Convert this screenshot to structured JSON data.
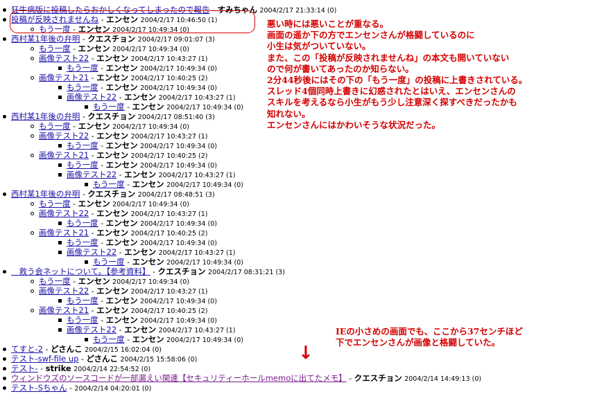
{
  "threads": [
    {
      "id": "r0",
      "level": 0,
      "bullet": "disc",
      "title": "狂牛病版に投稿したらおかしくなってしまったので報告",
      "sep": " - ",
      "author": "すみちゃん",
      "meta": "2004/2/17 21:33:14 (0)",
      "link": "blue"
    },
    {
      "id": "r1",
      "level": 0,
      "bullet": "disc",
      "title": "投稿が反映されませんね",
      "sep": " - ",
      "author": "エンセン",
      "meta": "2004/2/17 10:46:50 (1)",
      "link": "blue"
    },
    {
      "id": "r2",
      "level": 1,
      "bullet": "circle",
      "title": "もう一度",
      "sep": " - ",
      "author": "エンセン",
      "meta": "2004/2/17 10:49:34 (0)",
      "link": "blue"
    },
    {
      "id": "r3",
      "level": 0,
      "bullet": "disc",
      "title": "西村某1年後の弁明",
      "sep": " - ",
      "author": "クエスチョン",
      "meta": "2004/2/17 09:01:07 (3)",
      "link": "blue"
    },
    {
      "id": "r4",
      "level": 1,
      "bullet": "circle",
      "title": "もう一度",
      "sep": " - ",
      "author": "エンセン",
      "meta": "2004/2/17 10:49:34 (0)",
      "link": "blue"
    },
    {
      "id": "r5",
      "level": 1,
      "bullet": "circle",
      "title": "画像テスト22",
      "sep": " - ",
      "author": "エンセン",
      "meta": "2004/2/17 10:43:27 (1)",
      "link": "blue"
    },
    {
      "id": "r6",
      "level": 2,
      "bullet": "square",
      "title": "もう一度",
      "sep": " - ",
      "author": "エンセン",
      "meta": "2004/2/17 10:49:34 (0)",
      "link": "blue"
    },
    {
      "id": "r7",
      "level": 1,
      "bullet": "circle",
      "title": "画像テスト21",
      "sep": " - ",
      "author": "エンセン",
      "meta": "2004/2/17 10:40:25 (2)",
      "link": "blue"
    },
    {
      "id": "r8",
      "level": 2,
      "bullet": "square",
      "title": "もう一度",
      "sep": " - ",
      "author": "エンセン",
      "meta": "2004/2/17 10:49:34 (0)",
      "link": "blue"
    },
    {
      "id": "r9",
      "level": 2,
      "bullet": "square",
      "title": "画像テスト22",
      "sep": " - ",
      "author": "エンセン",
      "meta": "2004/2/17 10:43:27 (1)",
      "link": "blue"
    },
    {
      "id": "r10",
      "level": 3,
      "bullet": "square",
      "title": "もう一度",
      "sep": " - ",
      "author": "エンセン",
      "meta": "2004/2/17 10:49:34 (0)",
      "link": "blue"
    },
    {
      "id": "r11",
      "level": 0,
      "bullet": "disc",
      "title": "西村某1年後の弁明",
      "sep": " - ",
      "author": "クエスチョン",
      "meta": "2004/2/17 08:51:40 (3)",
      "link": "blue"
    },
    {
      "id": "r12",
      "level": 1,
      "bullet": "circle",
      "title": "もう一度",
      "sep": " - ",
      "author": "エンセン",
      "meta": "2004/2/17 10:49:34 (0)",
      "link": "blue"
    },
    {
      "id": "r13",
      "level": 1,
      "bullet": "circle",
      "title": "画像テスト22",
      "sep": " - ",
      "author": "エンセン",
      "meta": "2004/2/17 10:43:27 (1)",
      "link": "blue"
    },
    {
      "id": "r14",
      "level": 2,
      "bullet": "square",
      "title": "もう一度",
      "sep": " - ",
      "author": "エンセン",
      "meta": "2004/2/17 10:49:34 (0)",
      "link": "blue"
    },
    {
      "id": "r15",
      "level": 1,
      "bullet": "circle",
      "title": "画像テスト21",
      "sep": " - ",
      "author": "エンセン",
      "meta": "2004/2/17 10:40:25 (2)",
      "link": "blue"
    },
    {
      "id": "r16",
      "level": 2,
      "bullet": "square",
      "title": "もう一度",
      "sep": " - ",
      "author": "エンセン",
      "meta": "2004/2/17 10:49:34 (0)",
      "link": "blue"
    },
    {
      "id": "r17",
      "level": 2,
      "bullet": "square",
      "title": "画像テスト22",
      "sep": " - ",
      "author": "エンセン",
      "meta": "2004/2/17 10:43:27 (1)",
      "link": "blue"
    },
    {
      "id": "r18",
      "level": 3,
      "bullet": "square",
      "title": "もう一度",
      "sep": " - ",
      "author": "エンセン",
      "meta": "2004/2/17 10:49:34 (0)",
      "link": "blue"
    },
    {
      "id": "r19",
      "level": 0,
      "bullet": "disc",
      "title": "西村某1年後の弁明",
      "sep": " - ",
      "author": "クエスチョン",
      "meta": "2004/2/17 08:48:51 (3)",
      "link": "blue"
    },
    {
      "id": "r20",
      "level": 1,
      "bullet": "circle",
      "title": "もう一度",
      "sep": " - ",
      "author": "エンセン",
      "meta": "2004/2/17 10:49:34 (0)",
      "link": "blue"
    },
    {
      "id": "r21",
      "level": 1,
      "bullet": "circle",
      "title": "画像テスト22",
      "sep": " - ",
      "author": "エンセン",
      "meta": "2004/2/17 10:43:27 (1)",
      "link": "blue"
    },
    {
      "id": "r22",
      "level": 2,
      "bullet": "square",
      "title": "もう一度",
      "sep": " - ",
      "author": "エンセン",
      "meta": "2004/2/17 10:49:34 (0)",
      "link": "blue"
    },
    {
      "id": "r23",
      "level": 1,
      "bullet": "circle",
      "title": "画像テスト21",
      "sep": " - ",
      "author": "エンセン",
      "meta": "2004/2/17 10:40:25 (2)",
      "link": "blue"
    },
    {
      "id": "r24",
      "level": 2,
      "bullet": "square",
      "title": "もう一度",
      "sep": " - ",
      "author": "エンセン",
      "meta": "2004/2/17 10:49:34 (0)",
      "link": "blue"
    },
    {
      "id": "r25",
      "level": 2,
      "bullet": "square",
      "title": "画像テスト22",
      "sep": " - ",
      "author": "エンセン",
      "meta": "2004/2/17 10:43:27 (1)",
      "link": "blue"
    },
    {
      "id": "r26",
      "level": 3,
      "bullet": "square",
      "title": "もう一度",
      "sep": " - ",
      "author": "エンセン",
      "meta": "2004/2/17 10:49:34 (0)",
      "link": "blue"
    },
    {
      "id": "r27",
      "level": 0,
      "bullet": "disc",
      "title": "　救う会ネットについて。【参考資料】",
      "sep": " - ",
      "author": "クエスチョン",
      "meta": "2004/2/17 08:31:21 (3)",
      "link": "blue"
    },
    {
      "id": "r28",
      "level": 1,
      "bullet": "circle",
      "title": "もう一度",
      "sep": " - ",
      "author": "エンセン",
      "meta": "2004/2/17 10:49:34 (0)",
      "link": "blue"
    },
    {
      "id": "r29",
      "level": 1,
      "bullet": "circle",
      "title": "画像テスト22",
      "sep": " - ",
      "author": "エンセン",
      "meta": "2004/2/17 10:43:27 (1)",
      "link": "blue"
    },
    {
      "id": "r30",
      "level": 2,
      "bullet": "square",
      "title": "もう一度",
      "sep": " - ",
      "author": "エンセン",
      "meta": "2004/2/17 10:49:34 (0)",
      "link": "blue"
    },
    {
      "id": "r31",
      "level": 1,
      "bullet": "circle",
      "title": "画像テスト21",
      "sep": " - ",
      "author": "エンセン",
      "meta": "2004/2/17 10:40:25 (2)",
      "link": "blue"
    },
    {
      "id": "r32",
      "level": 2,
      "bullet": "square",
      "title": "もう一度",
      "sep": " - ",
      "author": "エンセン",
      "meta": "2004/2/17 10:49:34 (0)",
      "link": "blue"
    },
    {
      "id": "r33",
      "level": 2,
      "bullet": "square",
      "title": "画像テスト22",
      "sep": " - ",
      "author": "エンセン",
      "meta": "2004/2/17 10:43:27 (1)",
      "link": "blue"
    },
    {
      "id": "r34",
      "level": 3,
      "bullet": "square",
      "title": "もう一度",
      "sep": " - ",
      "author": "エンセン",
      "meta": "2004/2/17 10:49:34 (0)",
      "link": "blue"
    },
    {
      "id": "r35",
      "level": 0,
      "bullet": "disc",
      "title": "てすと-2",
      "sep": " - ",
      "author": "どさんこ",
      "meta": "2004/2/15 16:02:04 (0)",
      "link": "blue"
    },
    {
      "id": "r36",
      "level": 0,
      "bullet": "disc",
      "title": "テスト-swf-file up",
      "sep": " - ",
      "author": "どさんこ",
      "meta": "2004/2/15 15:58:06 (0)",
      "link": "blue"
    },
    {
      "id": "r37",
      "level": 0,
      "bullet": "disc",
      "title": "テスト-",
      "sep": " - ",
      "author": "strike",
      "meta": "2004/2/14 22:54:52 (0)",
      "link": "blue"
    },
    {
      "id": "r38",
      "level": 0,
      "bullet": "disc",
      "title": "ウィンドウズのソースコードが一部漏えい関連【セキュリティーホールmemoに出てたメモ】",
      "sep": " - ",
      "author": "クエスチョン",
      "meta": "2004/2/14 14:49:13 (0)",
      "link": "purple"
    },
    {
      "id": "r39",
      "level": 0,
      "bullet": "disc",
      "title": "テスト-Sちゃん",
      "sep": " - ",
      "author": "",
      "meta": "2004/2/14 04:20:01 (0)",
      "link": "blue"
    }
  ],
  "annotation_top": "悪い時には悪いことが重なる。\n画面の遥か下の方でエンセンさんが格闘しているのに\n小生は気がついていない。\nまた、この「投稿が反映されませんね」の本文も開いていない\nので何が書いてあったのか知らない。\n2分44秒後にはその下の「もう一度」の投稿に上書きされている。\nスレッド4個同時上書きに幻惑されたとはいえ、エンセンさんの\nスキルを考えるなら小生がもう少し注意深く探すべきだったかも\n知れない。\nエンセンさんにはかわいそうな状況だった。",
  "annotation_bottom": "IEの小さめの画面でも、ここから37センチほど\n下でエンセンさんが画像と格闘していた。",
  "arrow_glyph": "↓",
  "colors": {
    "link": "#1a10a8",
    "visited": "#7a1c8c",
    "annotation": "#d40000"
  }
}
